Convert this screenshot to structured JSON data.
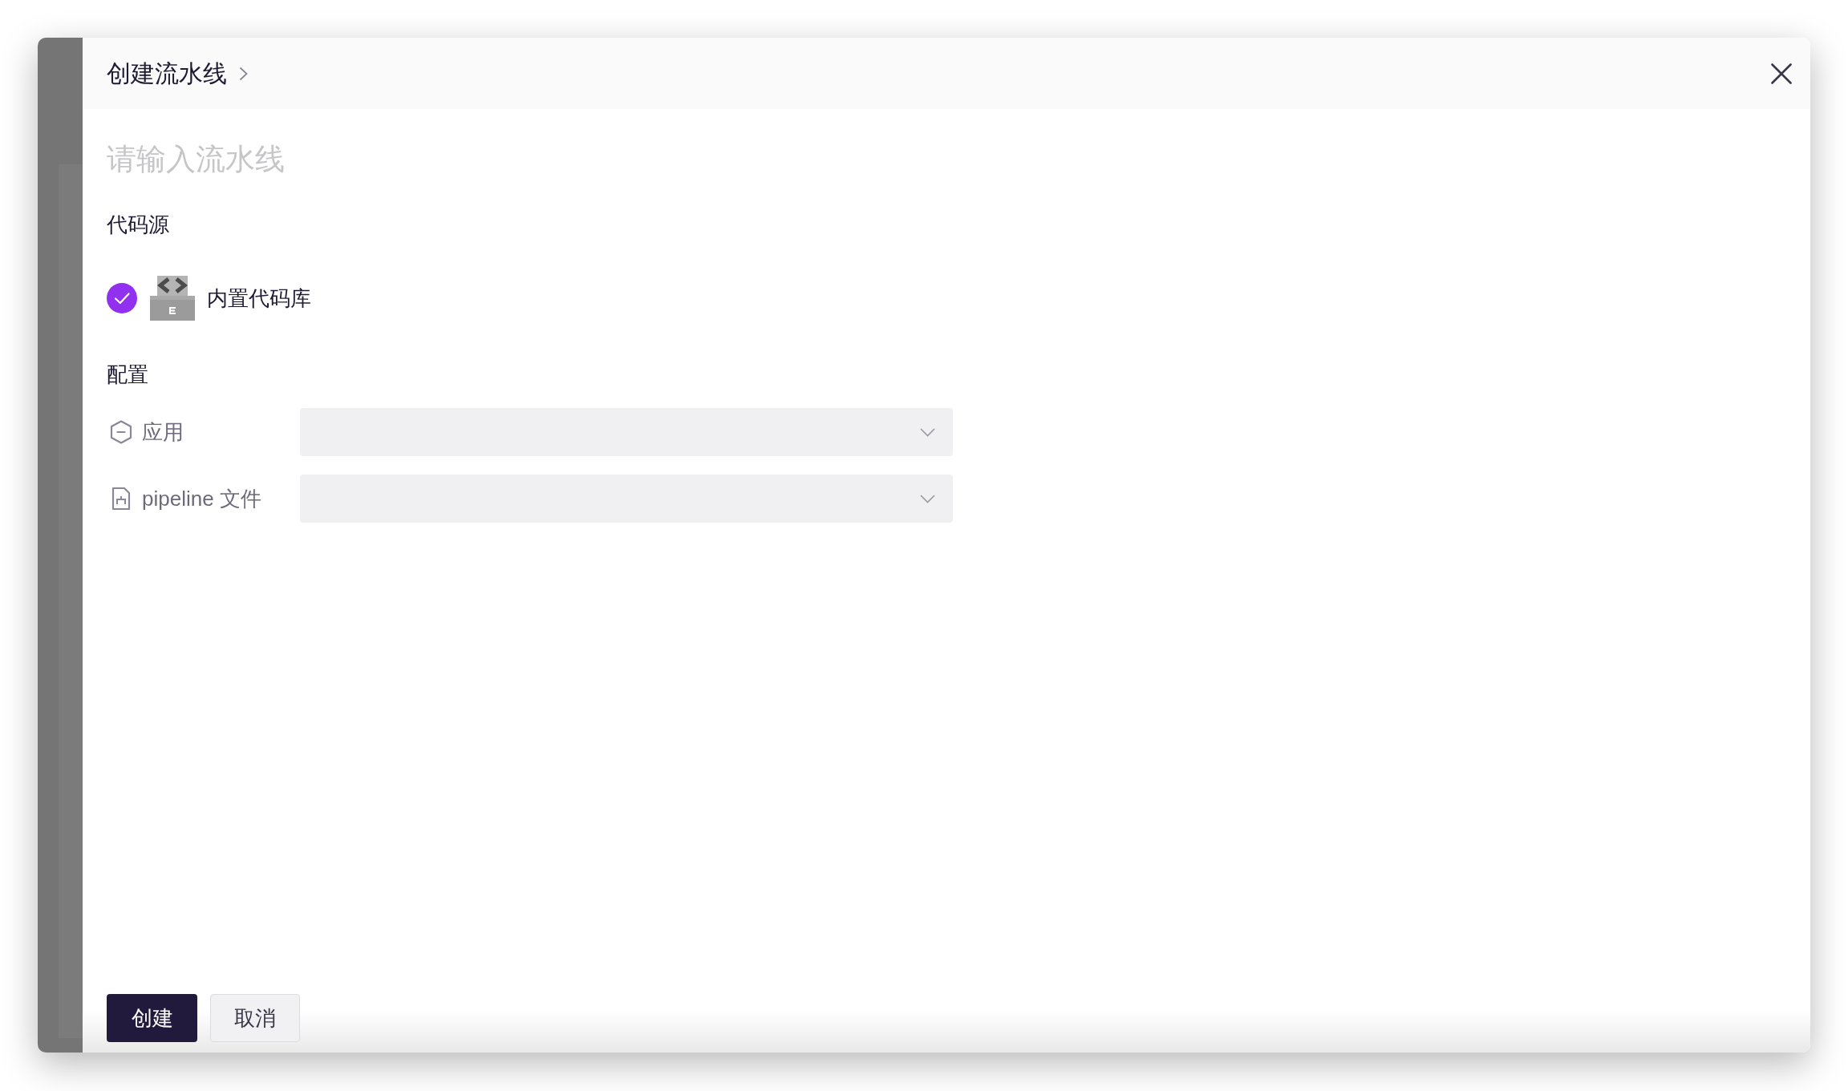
{
  "drawer": {
    "title": "创建流水线",
    "name_field": {
      "placeholder": "请输入流水线"
    },
    "code_source": {
      "heading": "代码源",
      "options": [
        {
          "label": "内置代码库",
          "selected": true
        }
      ]
    },
    "config": {
      "heading": "配置",
      "fields": [
        {
          "label": "应用",
          "kind": "app"
        },
        {
          "label": "pipeline 文件",
          "kind": "file"
        }
      ]
    },
    "buttons": [
      {
        "label": "创建",
        "kind": "primary"
      },
      {
        "label": "取消",
        "kind": "secondary"
      }
    ]
  }
}
